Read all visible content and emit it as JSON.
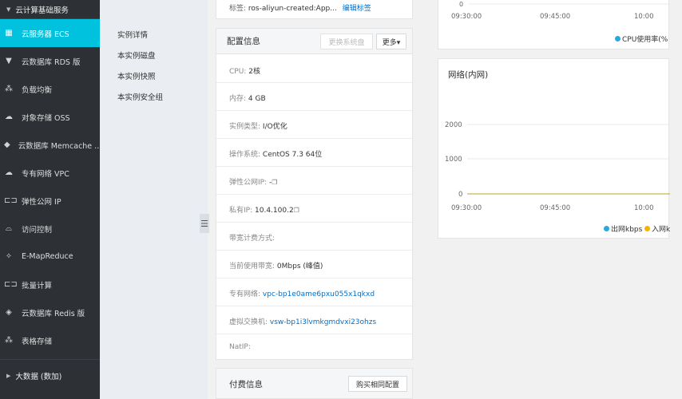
{
  "sidebar": {
    "group_title": "云计算基础服务",
    "items": [
      {
        "label": "云服务器 ECS",
        "icon": "server-icon",
        "glyph": "▦"
      },
      {
        "label": "云数据库 RDS 版",
        "icon": "database-icon",
        "glyph": "▼"
      },
      {
        "label": "负载均衡",
        "icon": "load-balancer-icon",
        "glyph": "⁂"
      },
      {
        "label": "对象存储 OSS",
        "icon": "cloud-storage-icon",
        "glyph": "☁"
      },
      {
        "label": "云数据库 Memcache ...",
        "icon": "memcache-icon",
        "glyph": "◆"
      },
      {
        "label": "专有网络 VPC",
        "icon": "vpc-cloud-icon",
        "glyph": "☁"
      },
      {
        "label": "弹性公网 IP",
        "icon": "eip-icon",
        "glyph": "⊏⊐"
      },
      {
        "label": "访问控制",
        "icon": "access-control-icon",
        "glyph": "⌓"
      },
      {
        "label": "E-MapReduce",
        "icon": "emapreduce-icon",
        "glyph": "✧"
      },
      {
        "label": "批量计算",
        "icon": "batch-compute-icon",
        "glyph": "⊏⊐"
      },
      {
        "label": "云数据库 Redis 版",
        "icon": "redis-icon",
        "glyph": "◈"
      },
      {
        "label": "表格存储",
        "icon": "table-store-icon",
        "glyph": "⁂"
      }
    ],
    "bottom_group": "大数据 (数加)"
  },
  "subnav": {
    "items": [
      "实例详情",
      "本实例磁盘",
      "本实例快照",
      "本实例安全组"
    ]
  },
  "tags": {
    "label": "标签:",
    "value": "ros-aliyun-created:App...",
    "edit_link": "编辑标签"
  },
  "config": {
    "title": "配置信息",
    "btn_change_disk": "更换系统盘",
    "btn_more": "更多▾",
    "rows": {
      "cpu_label": "CPU:",
      "cpu_value": "2核",
      "mem_label": "内存:",
      "mem_value": "4 GB",
      "type_label": "实例类型:",
      "type_value": "I/O优化",
      "os_label": "操作系统:",
      "os_value": "CentOS 7.3 64位",
      "eip_label": "弹性公网IP:",
      "eip_value": "-",
      "private_ip_label": "私有IP:",
      "private_ip_value": "10.4.100.2",
      "billing_method_label": "带宽计费方式:",
      "bandwidth_label": "当前使用带宽:",
      "bandwidth_value": "0Mbps (峰值)",
      "vpc_label": "专有网络:",
      "vpc_value": "vpc-bp1e0ame6pxu055x1qkxd",
      "vswitch_label": "虚拟交换机:",
      "vswitch_value": "vsw-bp1i3lvmkgmdvxi23ohzs",
      "natip_label": "NatIP:"
    }
  },
  "payment": {
    "title": "付费信息",
    "btn_buy_same": "购买相同配置"
  },
  "cpu_chart": {
    "tick_top": "0",
    "x_ticks": [
      "09:30:00",
      "09:45:00",
      "10:00"
    ],
    "legend": "CPU使用率(%",
    "legend_color": "#29a8e0"
  },
  "network_chart": {
    "title": "网络(内网)",
    "y_ticks": [
      "2000",
      "1000",
      "0"
    ],
    "x_ticks": [
      "09:30:00",
      "09:45:00",
      "10:00"
    ],
    "legend_out": "出网kbps",
    "legend_in": "入网k",
    "out_color": "#29a8e0",
    "in_color": "#f5b300"
  },
  "chart_data": [
    {
      "type": "line",
      "title": "",
      "x": [
        "09:30:00",
        "09:45:00",
        "10:00"
      ],
      "series": [
        {
          "name": "CPU使用率(%",
          "values": [
            0,
            0,
            0
          ]
        }
      ]
    },
    {
      "type": "line",
      "title": "网络(内网)",
      "x": [
        "09:30:00",
        "09:45:00",
        "10:00"
      ],
      "ylim": [
        0,
        2000
      ],
      "series": [
        {
          "name": "出网kbps",
          "values": [
            0,
            0,
            0
          ]
        },
        {
          "name": "入网k",
          "values": [
            0,
            0,
            0
          ]
        }
      ]
    }
  ]
}
